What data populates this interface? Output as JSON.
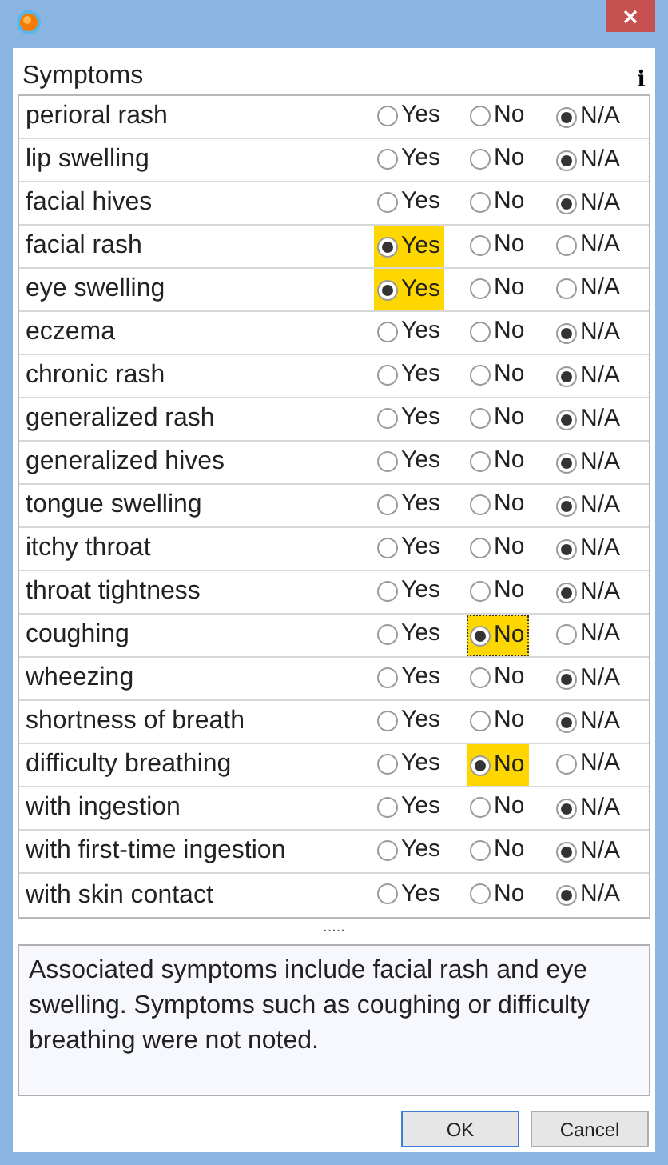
{
  "header": {
    "title": "Symptoms",
    "info_glyph": "i"
  },
  "symptoms": [
    {
      "name": "perioral rash",
      "options": [
        {
          "label": "Yes",
          "selected": false,
          "highlighted": false,
          "focused": false
        },
        {
          "label": "No",
          "selected": false,
          "highlighted": false,
          "focused": false
        },
        {
          "label": "N/A",
          "selected": true,
          "highlighted": false,
          "focused": false
        }
      ]
    },
    {
      "name": "lip swelling",
      "options": [
        {
          "label": "Yes",
          "selected": false,
          "highlighted": false,
          "focused": false
        },
        {
          "label": "No",
          "selected": false,
          "highlighted": false,
          "focused": false
        },
        {
          "label": "N/A",
          "selected": true,
          "highlighted": false,
          "focused": false
        }
      ]
    },
    {
      "name": "facial hives",
      "options": [
        {
          "label": "Yes",
          "selected": false,
          "highlighted": false,
          "focused": false
        },
        {
          "label": "No",
          "selected": false,
          "highlighted": false,
          "focused": false
        },
        {
          "label": "N/A",
          "selected": true,
          "highlighted": false,
          "focused": false
        }
      ]
    },
    {
      "name": "facial rash",
      "options": [
        {
          "label": "Yes",
          "selected": true,
          "highlighted": true,
          "focused": false
        },
        {
          "label": "No",
          "selected": false,
          "highlighted": false,
          "focused": false
        },
        {
          "label": "N/A",
          "selected": false,
          "highlighted": false,
          "focused": false
        }
      ]
    },
    {
      "name": "eye swelling",
      "options": [
        {
          "label": "Yes",
          "selected": true,
          "highlighted": true,
          "focused": false
        },
        {
          "label": "No",
          "selected": false,
          "highlighted": false,
          "focused": false
        },
        {
          "label": "N/A",
          "selected": false,
          "highlighted": false,
          "focused": false
        }
      ]
    },
    {
      "name": "eczema",
      "options": [
        {
          "label": "Yes",
          "selected": false,
          "highlighted": false,
          "focused": false
        },
        {
          "label": "No",
          "selected": false,
          "highlighted": false,
          "focused": false
        },
        {
          "label": "N/A",
          "selected": true,
          "highlighted": false,
          "focused": false
        }
      ]
    },
    {
      "name": "chronic rash",
      "options": [
        {
          "label": "Yes",
          "selected": false,
          "highlighted": false,
          "focused": false
        },
        {
          "label": "No",
          "selected": false,
          "highlighted": false,
          "focused": false
        },
        {
          "label": "N/A",
          "selected": true,
          "highlighted": false,
          "focused": false
        }
      ]
    },
    {
      "name": "generalized rash",
      "options": [
        {
          "label": "Yes",
          "selected": false,
          "highlighted": false,
          "focused": false
        },
        {
          "label": "No",
          "selected": false,
          "highlighted": false,
          "focused": false
        },
        {
          "label": "N/A",
          "selected": true,
          "highlighted": false,
          "focused": false
        }
      ]
    },
    {
      "name": "generalized hives",
      "options": [
        {
          "label": "Yes",
          "selected": false,
          "highlighted": false,
          "focused": false
        },
        {
          "label": "No",
          "selected": false,
          "highlighted": false,
          "focused": false
        },
        {
          "label": "N/A",
          "selected": true,
          "highlighted": false,
          "focused": false
        }
      ]
    },
    {
      "name": "tongue swelling",
      "options": [
        {
          "label": "Yes",
          "selected": false,
          "highlighted": false,
          "focused": false
        },
        {
          "label": "No",
          "selected": false,
          "highlighted": false,
          "focused": false
        },
        {
          "label": "N/A",
          "selected": true,
          "highlighted": false,
          "focused": false
        }
      ]
    },
    {
      "name": "itchy throat",
      "options": [
        {
          "label": "Yes",
          "selected": false,
          "highlighted": false,
          "focused": false
        },
        {
          "label": "No",
          "selected": false,
          "highlighted": false,
          "focused": false
        },
        {
          "label": "N/A",
          "selected": true,
          "highlighted": false,
          "focused": false
        }
      ]
    },
    {
      "name": "throat tightness",
      "options": [
        {
          "label": "Yes",
          "selected": false,
          "highlighted": false,
          "focused": false
        },
        {
          "label": "No",
          "selected": false,
          "highlighted": false,
          "focused": false
        },
        {
          "label": "N/A",
          "selected": true,
          "highlighted": false,
          "focused": false
        }
      ]
    },
    {
      "name": "coughing",
      "options": [
        {
          "label": "Yes",
          "selected": false,
          "highlighted": false,
          "focused": false
        },
        {
          "label": "No",
          "selected": true,
          "highlighted": true,
          "focused": true
        },
        {
          "label": "N/A",
          "selected": false,
          "highlighted": false,
          "focused": false
        }
      ]
    },
    {
      "name": "wheezing",
      "options": [
        {
          "label": "Yes",
          "selected": false,
          "highlighted": false,
          "focused": false
        },
        {
          "label": "No",
          "selected": false,
          "highlighted": false,
          "focused": false
        },
        {
          "label": "N/A",
          "selected": true,
          "highlighted": false,
          "focused": false
        }
      ]
    },
    {
      "name": "shortness of breath",
      "options": [
        {
          "label": "Yes",
          "selected": false,
          "highlighted": false,
          "focused": false
        },
        {
          "label": "No",
          "selected": false,
          "highlighted": false,
          "focused": false
        },
        {
          "label": "N/A",
          "selected": true,
          "highlighted": false,
          "focused": false
        }
      ]
    },
    {
      "name": "difficulty breathing",
      "options": [
        {
          "label": "Yes",
          "selected": false,
          "highlighted": false,
          "focused": false
        },
        {
          "label": "No",
          "selected": true,
          "highlighted": true,
          "focused": false
        },
        {
          "label": "N/A",
          "selected": false,
          "highlighted": false,
          "focused": false
        }
      ]
    },
    {
      "name": "with ingestion",
      "options": [
        {
          "label": "Yes",
          "selected": false,
          "highlighted": false,
          "focused": false
        },
        {
          "label": "No",
          "selected": false,
          "highlighted": false,
          "focused": false
        },
        {
          "label": "N/A",
          "selected": true,
          "highlighted": false,
          "focused": false
        }
      ]
    },
    {
      "name": "with first-time ingestion",
      "options": [
        {
          "label": "Yes",
          "selected": false,
          "highlighted": false,
          "focused": false
        },
        {
          "label": "No",
          "selected": false,
          "highlighted": false,
          "focused": false
        },
        {
          "label": "N/A",
          "selected": true,
          "highlighted": false,
          "focused": false
        }
      ]
    },
    {
      "name": "with skin contact",
      "options": [
        {
          "label": "Yes",
          "selected": false,
          "highlighted": false,
          "focused": false
        },
        {
          "label": "No",
          "selected": false,
          "highlighted": false,
          "focused": false
        },
        {
          "label": "N/A",
          "selected": true,
          "highlighted": false,
          "focused": false
        }
      ]
    }
  ],
  "splitter": ".....",
  "notes": {
    "value": "Associated symptoms include facial rash and eye swelling. Symptoms such as coughing or difficulty breathing were not noted."
  },
  "buttons": [
    "OK",
    "Cancel"
  ]
}
